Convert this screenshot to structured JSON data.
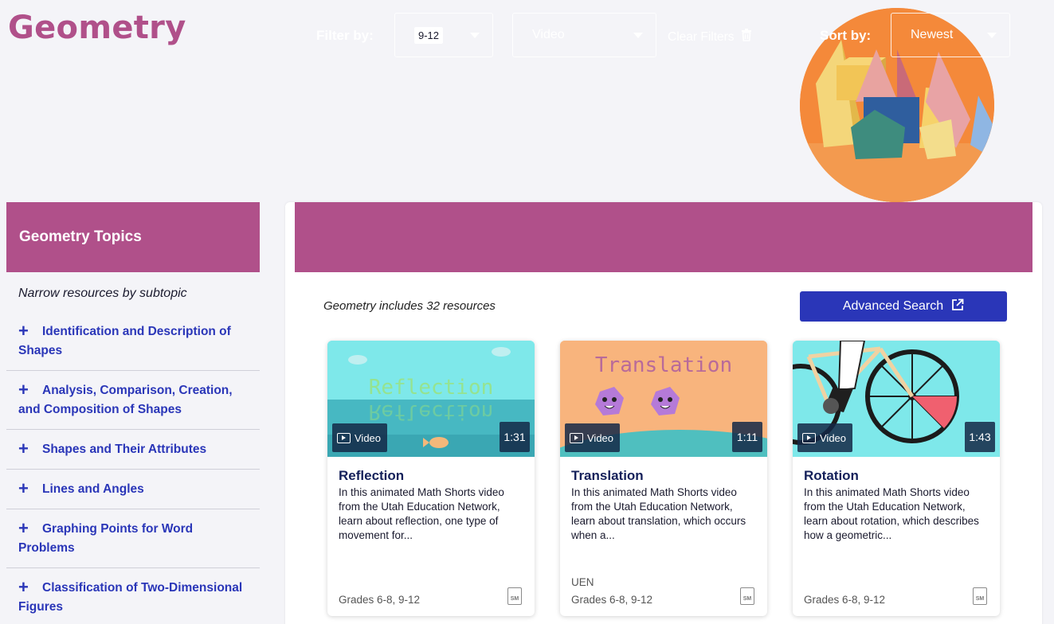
{
  "page": {
    "title": "Geometry"
  },
  "sidebar": {
    "heading": "Geometry Topics",
    "subheading": "Narrow resources by subtopic",
    "topics": [
      {
        "label": "Identification and Description of Shapes"
      },
      {
        "label": "Analysis, Comparison, Creation, and Composition of Shapes"
      },
      {
        "label": "Shapes and Their Attributes"
      },
      {
        "label": "Lines and Angles"
      },
      {
        "label": "Graphing Points for Word Problems"
      },
      {
        "label": "Classification of Two-Dimensional Figures"
      }
    ]
  },
  "filters": {
    "filter_label": "Filter by:",
    "grade_value": "9-12",
    "type_value": "Video",
    "clear_label": "Clear Filters",
    "sort_label": "Sort by:",
    "sort_value": "Newest"
  },
  "results": {
    "count_text": "Geometry includes 32 resources",
    "advanced_search_label": "Advanced Search"
  },
  "cards": [
    {
      "thumb_text": "Reflection",
      "badge": "Video",
      "duration": "1:31",
      "title": "Reflection",
      "description": "In this animated Math Shorts video from the Utah Education Network, learn about reflection, one type of movement for...",
      "source": "",
      "grades": "Grades 6-8, 9-12",
      "thumb_color": "#6fe3e3"
    },
    {
      "thumb_text": "Translation",
      "badge": "Video",
      "duration": "1:11",
      "title": "Translation",
      "description": "In this animated Math Shorts video from the Utah Education Network, learn about translation, which occurs when a...",
      "source": "UEN",
      "grades": "Grades 6-8, 9-12",
      "thumb_color": "#f7b27a"
    },
    {
      "thumb_text": "",
      "badge": "Video",
      "duration": "1:43",
      "title": "Rotation",
      "description": "In this animated Math Shorts video from the Utah Education Network, learn about rotation, which describes how a geometric...",
      "source": "",
      "grades": "Grades 6-8, 9-12",
      "thumb_color": "#6fe3e3"
    }
  ],
  "icons": {
    "plus": "plus-icon",
    "caret": "chevron-down-icon",
    "trash": "trash-icon",
    "external": "external-link-icon",
    "play": "video-play-icon",
    "file": "sm-file-icon"
  },
  "colors": {
    "brand": "#b0508a",
    "accent": "#2a36b8",
    "background": "#f4f4f8"
  }
}
